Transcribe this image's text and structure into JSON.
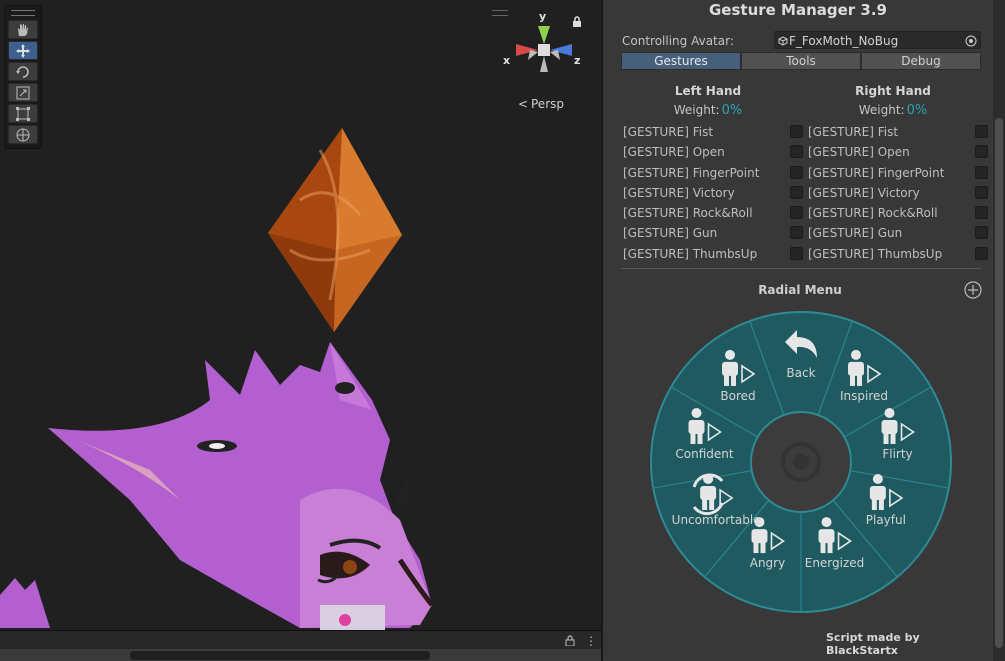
{
  "scene": {
    "gizmo": {
      "x_label": "x",
      "y_label": "y",
      "z_label": "z",
      "projection": "Persp",
      "projection_icon": "perspective-chevron-icon"
    },
    "tools": [
      "hand-tool-icon",
      "move-tool-icon",
      "rotate-tool-icon",
      "scale-tool-icon",
      "rect-tool-icon",
      "transform-tool-icon"
    ]
  },
  "panel": {
    "title": "Gesture Manager 3.9",
    "avatar_label": "Controlling Avatar:",
    "avatar_value": "F_FoxMoth_NoBug",
    "tabs": [
      "Gestures",
      "Tools",
      "Debug"
    ],
    "left": {
      "title": "Left Hand",
      "weight_label": "Weight:",
      "weight_value": "0%",
      "gestures": [
        "[GESTURE] Fist",
        "[GESTURE] Open",
        "[GESTURE] FingerPoint",
        "[GESTURE] Victory",
        "[GESTURE] Rock&Roll",
        "[GESTURE] Gun",
        "[GESTURE] ThumbsUp"
      ]
    },
    "right": {
      "title": "Right Hand",
      "weight_label": "Weight:",
      "weight_value": "0%",
      "gestures": [
        "[GESTURE] Fist",
        "[GESTURE] Open",
        "[GESTURE] FingerPoint",
        "[GESTURE] Victory",
        "[GESTURE] Rock&Roll",
        "[GESTURE] Gun",
        "[GESTURE] ThumbsUp"
      ]
    },
    "radial": {
      "title": "Radial Menu",
      "items": [
        {
          "label": "Back",
          "icon": "back-arrow-icon"
        },
        {
          "label": "Inspired",
          "icon": "person-icon"
        },
        {
          "label": "Flirty",
          "icon": "person-icon"
        },
        {
          "label": "Playful",
          "icon": "person-icon"
        },
        {
          "label": "Energized",
          "icon": "person-icon"
        },
        {
          "label": "Angry",
          "icon": "person-icon"
        },
        {
          "label": "Uncomfortable",
          "icon": "rotate-person-icon"
        },
        {
          "label": "Confident",
          "icon": "person-icon"
        },
        {
          "label": "Bored",
          "icon": "person-icon"
        }
      ]
    },
    "credit": "Script made by BlackStartx"
  },
  "colors": {
    "accent": "#2ea3b8",
    "active_tab": "#46607c",
    "radial_fill": "#1f5a60",
    "gem": "#c8621a",
    "fox": "#b35fcf"
  }
}
